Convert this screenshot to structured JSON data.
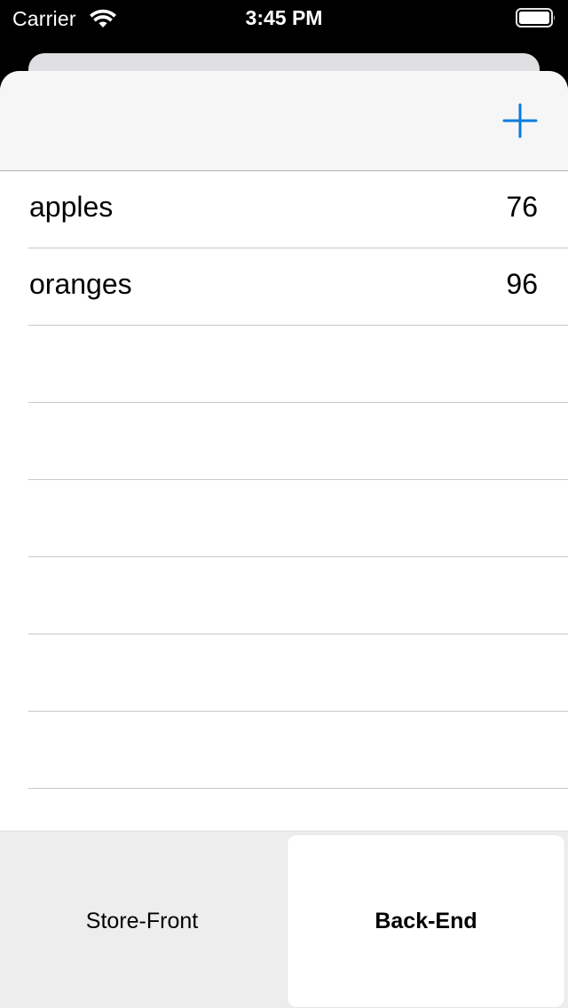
{
  "status_bar": {
    "carrier": "Carrier",
    "time": "3:45 PM",
    "wifi_icon": "wifi-icon",
    "battery_icon": "battery-icon"
  },
  "nav_bar": {
    "add_icon": "plus-icon",
    "accent_color": "#007aff"
  },
  "items": [
    {
      "name": "apples",
      "count": "76"
    },
    {
      "name": "oranges",
      "count": "96"
    }
  ],
  "tabs": [
    {
      "label": "Store-Front",
      "selected": false
    },
    {
      "label": "Back-End",
      "selected": true
    }
  ]
}
